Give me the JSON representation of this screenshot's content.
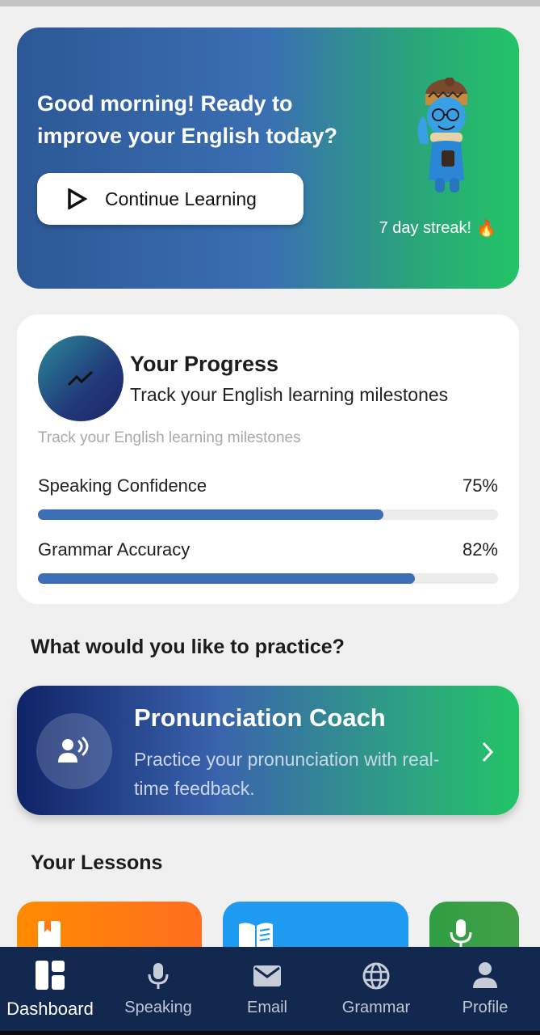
{
  "hero": {
    "greeting": "Good morning! Ready to improve your English today?",
    "button_label": "Continue Learning",
    "streak_text": "7 day streak!",
    "streak_emoji": "🔥"
  },
  "progress": {
    "title": "Your Progress",
    "subtitle": "Track your English learning milestones",
    "caption": "Track your English learning milestones",
    "metrics": [
      {
        "label": "Speaking Confidence",
        "value_text": "75%",
        "value": 0.75
      },
      {
        "label": "Grammar Accuracy",
        "value_text": "82%",
        "value": 0.82
      }
    ]
  },
  "practice_section": {
    "heading": "What would you like to practice?"
  },
  "practice_card": {
    "title": "Pronunciation Coach",
    "description": "Practice your pronunciation with real-time feedback."
  },
  "lessons_section": {
    "heading": "Your Lessons"
  },
  "lessons": [
    {
      "icon": "bookmark-icon",
      "color_from": "#ff8c00",
      "color_to": "#ff6d1f"
    },
    {
      "icon": "open-book-icon",
      "color_from": "#1e9bf0",
      "color_to": "#1e9bf0"
    },
    {
      "icon": "microphone-icon",
      "color_from": "#2f9e44",
      "color_to": "#43a047"
    }
  ],
  "nav": {
    "items": [
      {
        "label": "Dashboard",
        "icon": "dashboard-icon",
        "active": true
      },
      {
        "label": "Speaking",
        "icon": "microphone-icon",
        "active": false
      },
      {
        "label": "Email",
        "icon": "mail-icon",
        "active": false
      },
      {
        "label": "Grammar",
        "icon": "globe-icon",
        "active": false
      },
      {
        "label": "Profile",
        "icon": "person-icon",
        "active": false
      }
    ]
  },
  "colors": {
    "brand_blue": "#3d6fb6",
    "brand_green": "#23c466",
    "nav_bg": "#12284f"
  }
}
